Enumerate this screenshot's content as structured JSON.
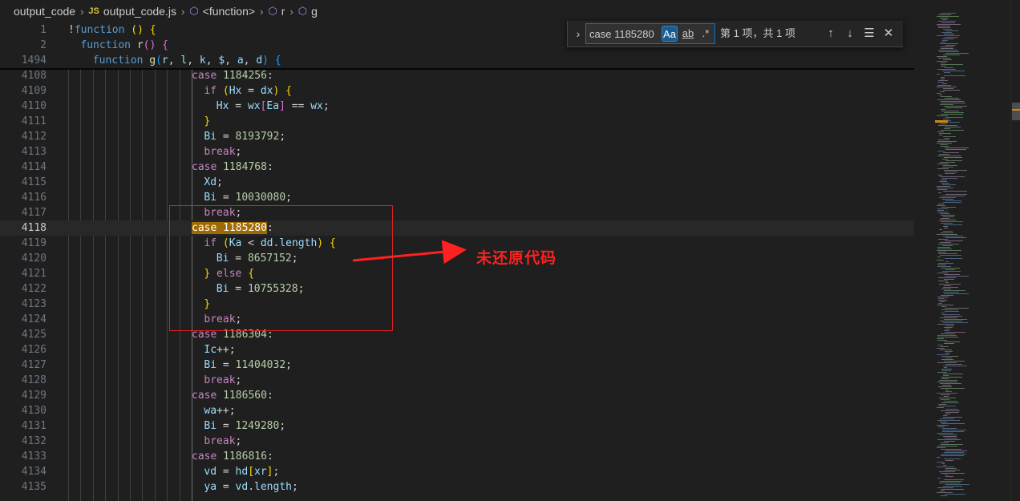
{
  "breadcrumb": {
    "folder": "output_code",
    "file_badge": "JS",
    "file": "output_code.js",
    "symbols": [
      "<function>",
      "r",
      "g"
    ]
  },
  "sticky_lines": [
    {
      "num": "1",
      "tokens": [
        [
          "punc",
          "!"
        ],
        [
          "kw",
          "function"
        ],
        [
          "punc",
          " "
        ],
        [
          "br1",
          "()"
        ],
        [
          "punc",
          " "
        ],
        [
          "br1",
          "{"
        ]
      ]
    },
    {
      "num": "2",
      "indent": 1,
      "tokens": [
        [
          "kw",
          "function"
        ],
        [
          "punc",
          " "
        ],
        [
          "fn",
          "r"
        ],
        [
          "br2",
          "()"
        ],
        [
          "punc",
          " "
        ],
        [
          "br2",
          "{"
        ]
      ]
    },
    {
      "num": "1494",
      "indent": 2,
      "tokens": [
        [
          "kw",
          "function"
        ],
        [
          "punc",
          " "
        ],
        [
          "fn",
          "g"
        ],
        [
          "br3",
          "("
        ],
        [
          "var",
          "r"
        ],
        [
          "punc",
          ", "
        ],
        [
          "var",
          "l"
        ],
        [
          "punc",
          ", "
        ],
        [
          "var",
          "k"
        ],
        [
          "punc",
          ", "
        ],
        [
          "var",
          "$"
        ],
        [
          "punc",
          ", "
        ],
        [
          "var",
          "a"
        ],
        [
          "punc",
          ", "
        ],
        [
          "var",
          "d"
        ],
        [
          "br3",
          ")"
        ],
        [
          "punc",
          " "
        ],
        [
          "br3",
          "{"
        ]
      ]
    }
  ],
  "lines": [
    {
      "num": "4108",
      "indent": 10,
      "tokens": [
        [
          "ctl",
          "case"
        ],
        [
          "punc",
          " "
        ],
        [
          "num",
          "1184256"
        ],
        [
          "punc",
          ":"
        ]
      ]
    },
    {
      "num": "4109",
      "indent": 11,
      "tokens": [
        [
          "ctl",
          "if"
        ],
        [
          "punc",
          " "
        ],
        [
          "br1",
          "("
        ],
        [
          "var",
          "Hx"
        ],
        [
          "punc",
          " = "
        ],
        [
          "var",
          "dx"
        ],
        [
          "br1",
          ")"
        ],
        [
          "punc",
          " "
        ],
        [
          "br1",
          "{"
        ]
      ]
    },
    {
      "num": "4110",
      "indent": 12,
      "tokens": [
        [
          "var",
          "Hx"
        ],
        [
          "punc",
          " = "
        ],
        [
          "var",
          "wx"
        ],
        [
          "br2",
          "["
        ],
        [
          "var",
          "Ea"
        ],
        [
          "br2",
          "]"
        ],
        [
          "punc",
          " == "
        ],
        [
          "var",
          "wx"
        ],
        [
          "punc",
          ";"
        ]
      ]
    },
    {
      "num": "4111",
      "indent": 11,
      "tokens": [
        [
          "br1",
          "}"
        ]
      ]
    },
    {
      "num": "4112",
      "indent": 11,
      "tokens": [
        [
          "var",
          "Bi"
        ],
        [
          "punc",
          " = "
        ],
        [
          "num",
          "8193792"
        ],
        [
          "punc",
          ";"
        ]
      ]
    },
    {
      "num": "4113",
      "indent": 11,
      "tokens": [
        [
          "ctl",
          "break"
        ],
        [
          "punc",
          ";"
        ]
      ]
    },
    {
      "num": "4114",
      "indent": 10,
      "tokens": [
        [
          "ctl",
          "case"
        ],
        [
          "punc",
          " "
        ],
        [
          "num",
          "1184768"
        ],
        [
          "punc",
          ":"
        ]
      ]
    },
    {
      "num": "4115",
      "indent": 11,
      "tokens": [
        [
          "var",
          "Xd"
        ],
        [
          "punc",
          ";"
        ]
      ]
    },
    {
      "num": "4116",
      "indent": 11,
      "tokens": [
        [
          "var",
          "Bi"
        ],
        [
          "punc",
          " = "
        ],
        [
          "num",
          "10030080"
        ],
        [
          "punc",
          ";"
        ]
      ]
    },
    {
      "num": "4117",
      "indent": 11,
      "tokens": [
        [
          "ctl",
          "break"
        ],
        [
          "punc",
          ";"
        ]
      ]
    },
    {
      "num": "4118",
      "indent": 10,
      "active": true,
      "tokens": [
        [
          "ctl match",
          "case"
        ],
        [
          "match",
          " "
        ],
        [
          "num match",
          "1185280"
        ],
        [
          "punc",
          ":"
        ]
      ]
    },
    {
      "num": "4119",
      "indent": 11,
      "tokens": [
        [
          "ctl",
          "if"
        ],
        [
          "punc",
          " "
        ],
        [
          "br1",
          "("
        ],
        [
          "var",
          "Ka"
        ],
        [
          "punc",
          " < "
        ],
        [
          "var",
          "dd"
        ],
        [
          "punc",
          "."
        ],
        [
          "var",
          "length"
        ],
        [
          "br1",
          ")"
        ],
        [
          "punc",
          " "
        ],
        [
          "br1",
          "{"
        ]
      ]
    },
    {
      "num": "4120",
      "indent": 12,
      "tokens": [
        [
          "var",
          "Bi"
        ],
        [
          "punc",
          " = "
        ],
        [
          "num",
          "8657152"
        ],
        [
          "punc",
          ";"
        ]
      ]
    },
    {
      "num": "4121",
      "indent": 11,
      "tokens": [
        [
          "br1",
          "}"
        ],
        [
          "punc",
          " "
        ],
        [
          "ctl",
          "else"
        ],
        [
          "punc",
          " "
        ],
        [
          "br1",
          "{"
        ]
      ]
    },
    {
      "num": "4122",
      "indent": 12,
      "tokens": [
        [
          "var",
          "Bi"
        ],
        [
          "punc",
          " = "
        ],
        [
          "num",
          "10755328"
        ],
        [
          "punc",
          ";"
        ]
      ]
    },
    {
      "num": "4123",
      "indent": 11,
      "tokens": [
        [
          "br1",
          "}"
        ]
      ]
    },
    {
      "num": "4124",
      "indent": 11,
      "tokens": [
        [
          "ctl",
          "break"
        ],
        [
          "punc",
          ";"
        ]
      ]
    },
    {
      "num": "4125",
      "indent": 10,
      "tokens": [
        [
          "ctl",
          "case"
        ],
        [
          "punc",
          " "
        ],
        [
          "num",
          "1186304"
        ],
        [
          "punc",
          ":"
        ]
      ]
    },
    {
      "num": "4126",
      "indent": 11,
      "tokens": [
        [
          "var",
          "Ic"
        ],
        [
          "punc",
          "++;"
        ]
      ]
    },
    {
      "num": "4127",
      "indent": 11,
      "tokens": [
        [
          "var",
          "Bi"
        ],
        [
          "punc",
          " = "
        ],
        [
          "num",
          "11404032"
        ],
        [
          "punc",
          ";"
        ]
      ]
    },
    {
      "num": "4128",
      "indent": 11,
      "tokens": [
        [
          "ctl",
          "break"
        ],
        [
          "punc",
          ";"
        ]
      ]
    },
    {
      "num": "4129",
      "indent": 10,
      "tokens": [
        [
          "ctl",
          "case"
        ],
        [
          "punc",
          " "
        ],
        [
          "num",
          "1186560"
        ],
        [
          "punc",
          ":"
        ]
      ]
    },
    {
      "num": "4130",
      "indent": 11,
      "tokens": [
        [
          "var",
          "wa"
        ],
        [
          "punc",
          "++;"
        ]
      ]
    },
    {
      "num": "4131",
      "indent": 11,
      "tokens": [
        [
          "var",
          "Bi"
        ],
        [
          "punc",
          " = "
        ],
        [
          "num",
          "1249280"
        ],
        [
          "punc",
          ";"
        ]
      ]
    },
    {
      "num": "4132",
      "indent": 11,
      "tokens": [
        [
          "ctl",
          "break"
        ],
        [
          "punc",
          ";"
        ]
      ]
    },
    {
      "num": "4133",
      "indent": 10,
      "tokens": [
        [
          "ctl",
          "case"
        ],
        [
          "punc",
          " "
        ],
        [
          "num",
          "1186816"
        ],
        [
          "punc",
          ":"
        ]
      ]
    },
    {
      "num": "4134",
      "indent": 11,
      "tokens": [
        [
          "var",
          "vd"
        ],
        [
          "punc",
          " = "
        ],
        [
          "var",
          "hd"
        ],
        [
          "br1",
          "["
        ],
        [
          "var",
          "xr"
        ],
        [
          "br1",
          "]"
        ],
        [
          "punc",
          ";"
        ]
      ]
    },
    {
      "num": "4135",
      "indent": 11,
      "tokens": [
        [
          "var",
          "ya"
        ],
        [
          "punc",
          " = "
        ],
        [
          "var",
          "vd"
        ],
        [
          "punc",
          "."
        ],
        [
          "var",
          "length"
        ],
        [
          "punc",
          ";"
        ]
      ]
    }
  ],
  "find": {
    "value": "case 1185280",
    "match_case": "Aa",
    "whole_word": "ab",
    "regex": ".*",
    "count": "第 1 项，共 1 项"
  },
  "annotation": {
    "text": "未还原代码",
    "color": "#ff2020"
  },
  "colors": {
    "background": "#1f1f1f",
    "accent": "#0078d4",
    "match_highlight": "#9e6a03"
  }
}
